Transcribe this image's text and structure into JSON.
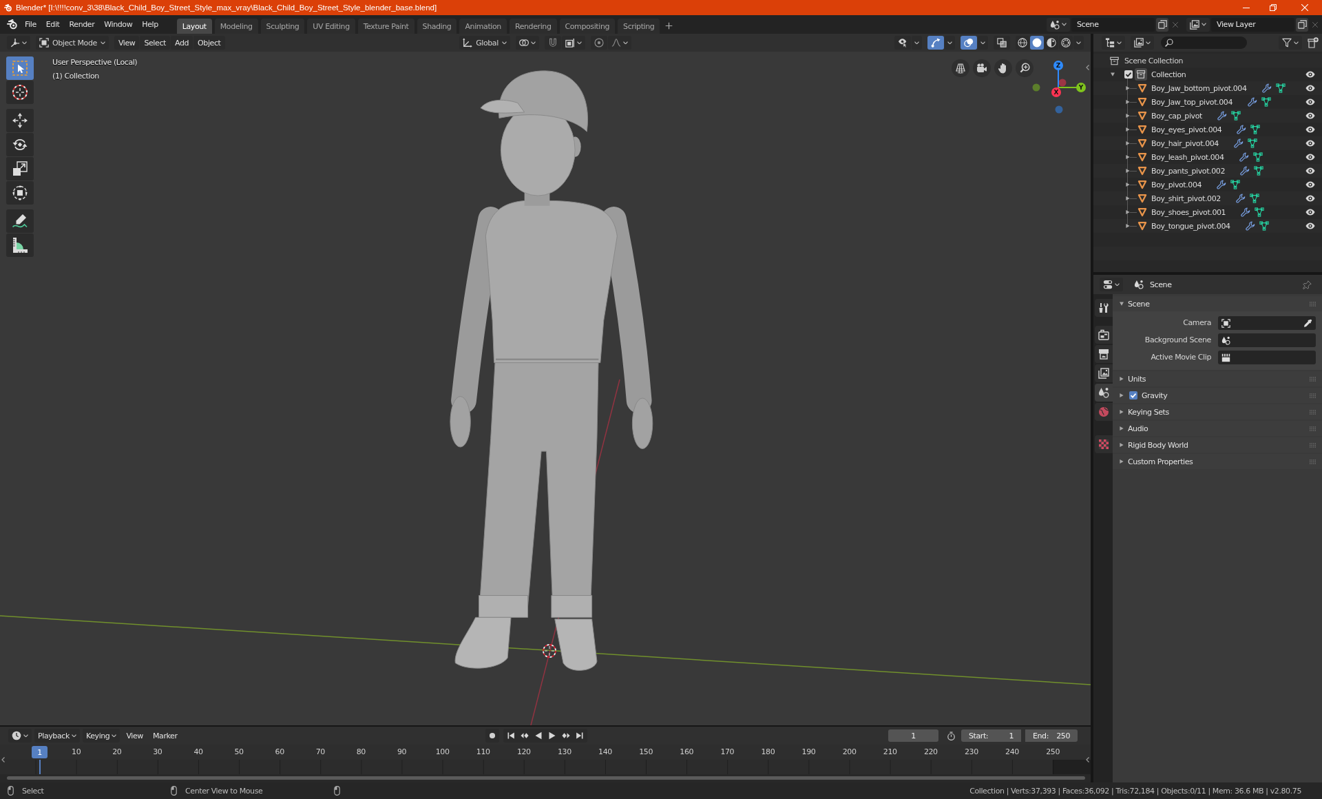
{
  "window": {
    "title": "Blender* [I:\\!!!!conv_3\\38\\Black_Child_Boy_Street_Style_max_vray\\Black_Child_Boy_Street_Style_blender_base.blend]"
  },
  "menu_bar": {
    "menus": [
      "File",
      "Edit",
      "Render",
      "Window",
      "Help"
    ]
  },
  "workspace_tabs": [
    {
      "label": "Layout",
      "selected": true
    },
    {
      "label": "Modeling",
      "selected": false
    },
    {
      "label": "Sculpting",
      "selected": false
    },
    {
      "label": "UV Editing",
      "selected": false
    },
    {
      "label": "Texture Paint",
      "selected": false
    },
    {
      "label": "Shading",
      "selected": false
    },
    {
      "label": "Animation",
      "selected": false
    },
    {
      "label": "Rendering",
      "selected": false
    },
    {
      "label": "Compositing",
      "selected": false
    },
    {
      "label": "Scripting",
      "selected": false
    }
  ],
  "scene_selector": {
    "value": "Scene"
  },
  "view_layer_selector": {
    "value": "View Layer"
  },
  "viewport": {
    "mode": "Object Mode",
    "menus": [
      "View",
      "Select",
      "Add",
      "Object"
    ],
    "orientation": "Global",
    "toggles": [
      {
        "kind": "visibility",
        "on": false
      },
      {
        "kind": "gizmos",
        "on": true
      },
      {
        "kind": "overlays",
        "on": true
      },
      {
        "kind": "xray",
        "on": false
      }
    ],
    "shading_modes": [
      {
        "kind": "wireframe",
        "selected": false
      },
      {
        "kind": "solid",
        "selected": true
      },
      {
        "kind": "material",
        "selected": false
      },
      {
        "kind": "rendered",
        "selected": false
      }
    ],
    "info": [
      "User Perspective (Local)",
      "(1) Collection"
    ],
    "tools": [
      {
        "kind": "select-box",
        "selected": true
      },
      {
        "kind": "cursor",
        "selected": false
      },
      {
        "kind": "move",
        "selected": false
      },
      {
        "kind": "rotate",
        "selected": false
      },
      {
        "kind": "scale",
        "selected": false
      },
      {
        "kind": "transform",
        "selected": false
      },
      {
        "kind": "annotate",
        "selected": false
      },
      {
        "kind": "measure",
        "selected": false
      }
    ],
    "gizmo_axes": [
      {
        "label": "Z",
        "color": "#2e8bff"
      },
      {
        "label": "Y",
        "color": "#7fc41d"
      },
      {
        "label": "X",
        "color": "#ff3352"
      }
    ]
  },
  "outliner": {
    "root": "Scene Collection",
    "collections": [
      {
        "name": "Collection",
        "expanded": true,
        "checked": true,
        "visible": true,
        "children": [
          {
            "name": "Boy_Jaw_bottom_pivot.004",
            "expanded": false,
            "visible": true
          },
          {
            "name": "Boy_Jaw_top_pivot.004",
            "expanded": false,
            "visible": true
          },
          {
            "name": "Boy_cap_pivot",
            "expanded": false,
            "visible": true
          },
          {
            "name": "Boy_eyes_pivot.004",
            "expanded": false,
            "visible": true
          },
          {
            "name": "Boy_hair_pivot.004",
            "expanded": false,
            "visible": true
          },
          {
            "name": "Boy_leash_pivot.004",
            "expanded": false,
            "visible": true
          },
          {
            "name": "Boy_pants_pivot.002",
            "expanded": false,
            "visible": true
          },
          {
            "name": "Boy_pivot.004",
            "expanded": false,
            "visible": true
          },
          {
            "name": "Boy_shirt_pivot.002",
            "expanded": false,
            "visible": true
          },
          {
            "name": "Boy_shoes_pivot.001",
            "expanded": false,
            "visible": true
          },
          {
            "name": "Boy_tongue_pivot.004",
            "expanded": false,
            "visible": true
          }
        ]
      }
    ]
  },
  "properties": {
    "context": "Scene",
    "tabs": [
      {
        "kind": "tool",
        "selected": false
      },
      {
        "kind": "render",
        "selected": false
      },
      {
        "kind": "output",
        "selected": false
      },
      {
        "kind": "view_layer",
        "selected": false
      },
      {
        "kind": "scene",
        "selected": true
      },
      {
        "kind": "world",
        "selected": false
      },
      {
        "kind": "texture",
        "selected": false
      }
    ],
    "panels": [
      {
        "title": "Scene",
        "expanded": true,
        "fields": [
          {
            "label": "Camera",
            "kind": "camera"
          },
          {
            "label": "Background Scene",
            "kind": "scene"
          },
          {
            "label": "Active Movie Clip",
            "kind": "movie-clip"
          }
        ]
      },
      {
        "title": "Units",
        "expanded": false
      },
      {
        "title": "Gravity",
        "expanded": false,
        "checked": true
      },
      {
        "title": "Keying Sets",
        "expanded": false
      },
      {
        "title": "Audio",
        "expanded": false
      },
      {
        "title": "Rigid Body World",
        "expanded": false
      },
      {
        "title": "Custom Properties",
        "expanded": false
      }
    ]
  },
  "timeline": {
    "menus": [
      {
        "label": "Playback",
        "kind": "dropdown"
      },
      {
        "label": "Keying",
        "kind": "dropdown"
      },
      {
        "label": "View",
        "kind": "menu"
      },
      {
        "label": "Marker",
        "kind": "menu"
      }
    ],
    "current_frame": "1",
    "start": {
      "label": "Start:",
      "value": "1"
    },
    "end": {
      "label": "End:",
      "value": "250"
    },
    "playhead": "1",
    "ruler": [
      "10",
      "20",
      "30",
      "40",
      "50",
      "60",
      "70",
      "80",
      "90",
      "100",
      "110",
      "120",
      "130",
      "140",
      "150",
      "160",
      "170",
      "180",
      "190",
      "200",
      "210",
      "220",
      "230",
      "240",
      "250"
    ]
  },
  "status_bar": {
    "hints": [
      "Select",
      "Center View to Mouse"
    ],
    "stats": "Collection | Verts:37,393 | Faces:36,092 | Tris:72,184 | Objects:0/11 | Mem: 36.6 MB | v2.80.75"
  }
}
